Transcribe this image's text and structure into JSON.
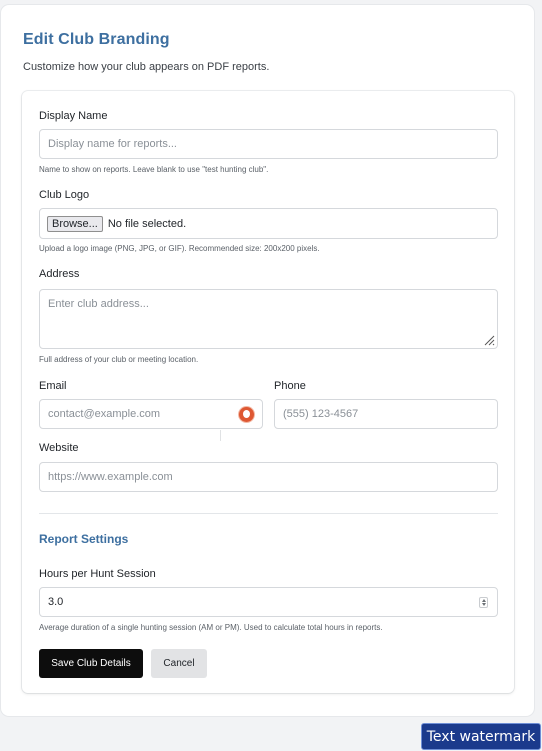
{
  "header": {
    "title": "Edit Club Branding",
    "subtitle": "Customize how your club appears on PDF reports."
  },
  "form": {
    "display_name": {
      "label": "Display Name",
      "placeholder": "Display name for reports...",
      "value": "",
      "help": "Name to show on reports. Leave blank to use \"test hunting club\"."
    },
    "club_logo": {
      "label": "Club Logo",
      "browse_label": "Browse...",
      "file_status": "No file selected.",
      "help": "Upload a logo image (PNG, JPG, or GIF). Recommended size: 200x200 pixels."
    },
    "address": {
      "label": "Address",
      "placeholder": "Enter club address...",
      "value": "",
      "help": "Full address of your club or meeting location."
    },
    "email": {
      "label": "Email",
      "placeholder": "contact@example.com",
      "value": "",
      "autofill_icon": "duckduckgo-icon"
    },
    "phone": {
      "label": "Phone",
      "placeholder": "(555) 123-4567",
      "value": ""
    },
    "website": {
      "label": "Website",
      "placeholder": "https://www.example.com",
      "value": ""
    }
  },
  "report_settings": {
    "title": "Report Settings",
    "hours_per_session": {
      "label": "Hours per Hunt Session",
      "value": "3.0",
      "help": "Average duration of a single hunting session (AM or PM). Used to calculate total hours in reports."
    }
  },
  "actions": {
    "save_label": "Save Club Details",
    "cancel_label": "Cancel"
  },
  "watermark": {
    "text": "Text watermark"
  },
  "colors": {
    "accent": "#3d6fa0",
    "primary_button": "#0d0d0d",
    "secondary_button": "#e2e3e5",
    "watermark_bg": "#1b3a8c"
  }
}
